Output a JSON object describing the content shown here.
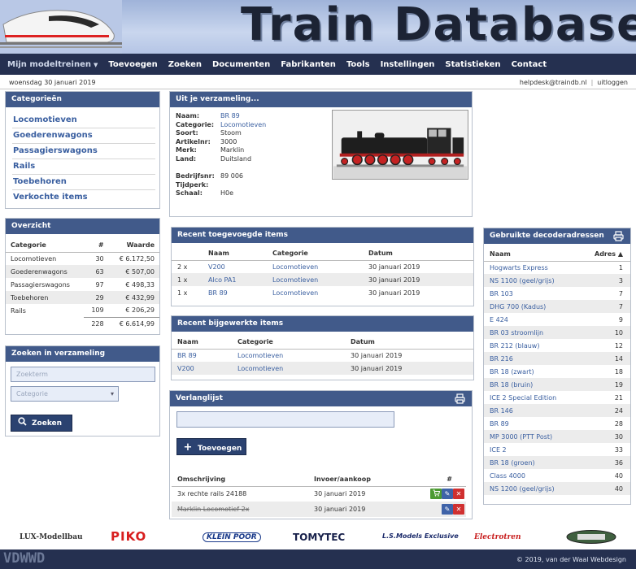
{
  "banner": {
    "title": "Train Database"
  },
  "menu": {
    "items": [
      "Mijn modeltreinen",
      "Toevoegen",
      "Zoeken",
      "Documenten",
      "Fabrikanten",
      "Tools",
      "Instellingen",
      "Statistieken",
      "Contact"
    ]
  },
  "subbar": {
    "date": "woensdag 30 januari 2019",
    "email": "helpdesk@traindb.nl",
    "logout": "uitloggen"
  },
  "categories": {
    "title": "Categorieën",
    "items": [
      "Locomotieven",
      "Goederenwagons",
      "Passagierswagons",
      "Rails",
      "Toebehoren",
      "Verkochte items"
    ]
  },
  "overview": {
    "title": "Overzicht",
    "headers": [
      "Categorie",
      "#",
      "Waarde"
    ],
    "rows": [
      [
        "Locomotieven",
        "30",
        "€ 6.172,50"
      ],
      [
        "Goederenwagons",
        "63",
        "€ 507,00"
      ],
      [
        "Passagierswagons",
        "97",
        "€ 498,33"
      ],
      [
        "Toebehoren",
        "29",
        "€ 432,99"
      ],
      [
        "Rails",
        "109",
        "€ 206,29"
      ]
    ],
    "total": [
      "",
      "228",
      "€ 6.614,99"
    ]
  },
  "search": {
    "title": "Zoeken in verzameling",
    "term_placeholder": "Zoekterm",
    "category_placeholder": "Categorie",
    "button": "Zoeken"
  },
  "item": {
    "title": "Uit je verzameling...",
    "fields": [
      {
        "k": "Naam:",
        "v": "BR 89"
      },
      {
        "k": "Categorie:",
        "v": "Locomotieven"
      },
      {
        "k": "Soort:",
        "v": "Stoom"
      },
      {
        "k": "Artikelnr:",
        "v": "3000"
      },
      {
        "k": "Merk:",
        "v": "Marklin"
      },
      {
        "k": "Land:",
        "v": "Duitsland"
      }
    ],
    "fields2": [
      {
        "k": "Bedrijfsnr:",
        "v": "89 006"
      },
      {
        "k": "Tijdperk:",
        "v": ""
      },
      {
        "k": "Schaal:",
        "v": "H0e"
      }
    ]
  },
  "recent_added": {
    "title": "Recent toegevoegde items",
    "headers": [
      "",
      "Naam",
      "Categorie",
      "Datum"
    ],
    "rows": [
      [
        "2 x",
        "V200",
        "Locomotieven",
        "30 januari 2019"
      ],
      [
        "1 x",
        "Alco PA1",
        "Locomotieven",
        "30 januari 2019"
      ],
      [
        "1 x",
        "BR 89",
        "Locomotieven",
        "30 januari 2019"
      ]
    ]
  },
  "recent_updated": {
    "title": "Recent bijgewerkte items",
    "headers": [
      "Naam",
      "Categorie",
      "Datum"
    ],
    "rows": [
      [
        "BR 89",
        "Locomotieven",
        "30 januari 2019"
      ],
      [
        "V200",
        "Locomotieven",
        "30 januari 2019"
      ]
    ]
  },
  "wishlist": {
    "title": "Verlanglijst",
    "button": "Toevoegen",
    "headers": [
      "Omschrijving",
      "Invoer/aankoop",
      "#"
    ],
    "rows": [
      [
        "3x rechte rails 24188",
        "30 januari 2019"
      ],
      [
        "Marklin Locomotief 2x",
        "30 januari 2019"
      ]
    ]
  },
  "decoder": {
    "title": "Gebruikte decoderadressen",
    "headers": [
      "Naam",
      "Adres ▲"
    ],
    "rows": [
      [
        "Hogwarts Express",
        "1"
      ],
      [
        "NS 1100 (geel/grijs)",
        "3"
      ],
      [
        "BR 103",
        "7"
      ],
      [
        "DHG 700 (Kadus)",
        "7"
      ],
      [
        "E 424",
        "9"
      ],
      [
        "BR 03 stroomlijn",
        "10"
      ],
      [
        "BR 212 (blauw)",
        "12"
      ],
      [
        "BR 216",
        "14"
      ],
      [
        "BR 18 (zwart)",
        "18"
      ],
      [
        "BR 18 (bruin)",
        "19"
      ],
      [
        "ICE 2 Special Edition",
        "21"
      ],
      [
        "BR 146",
        "24"
      ],
      [
        "BR 89",
        "28"
      ],
      [
        "MP 3000 (PTT Post)",
        "30"
      ],
      [
        "ICE 2",
        "33"
      ],
      [
        "BR 18 (groen)",
        "36"
      ],
      [
        "Class 4000",
        "40"
      ],
      [
        "NS 1200 (geel/grijs)",
        "40"
      ]
    ]
  },
  "brands": [
    "LUX-Modellbau",
    "PIKO",
    "KLEIN POOR",
    "TOMYTEC",
    "L.S.Models Exclusive",
    "Electrotren"
  ],
  "footer": {
    "mark": "VDWWD",
    "copy": "© 2019, van der Waal Webdesign"
  },
  "colors": {
    "menu_bg": "#253050",
    "panel_header": "#415a8a",
    "link": "#3a5fa0",
    "red": "#d03030",
    "green": "#4c9a32"
  }
}
